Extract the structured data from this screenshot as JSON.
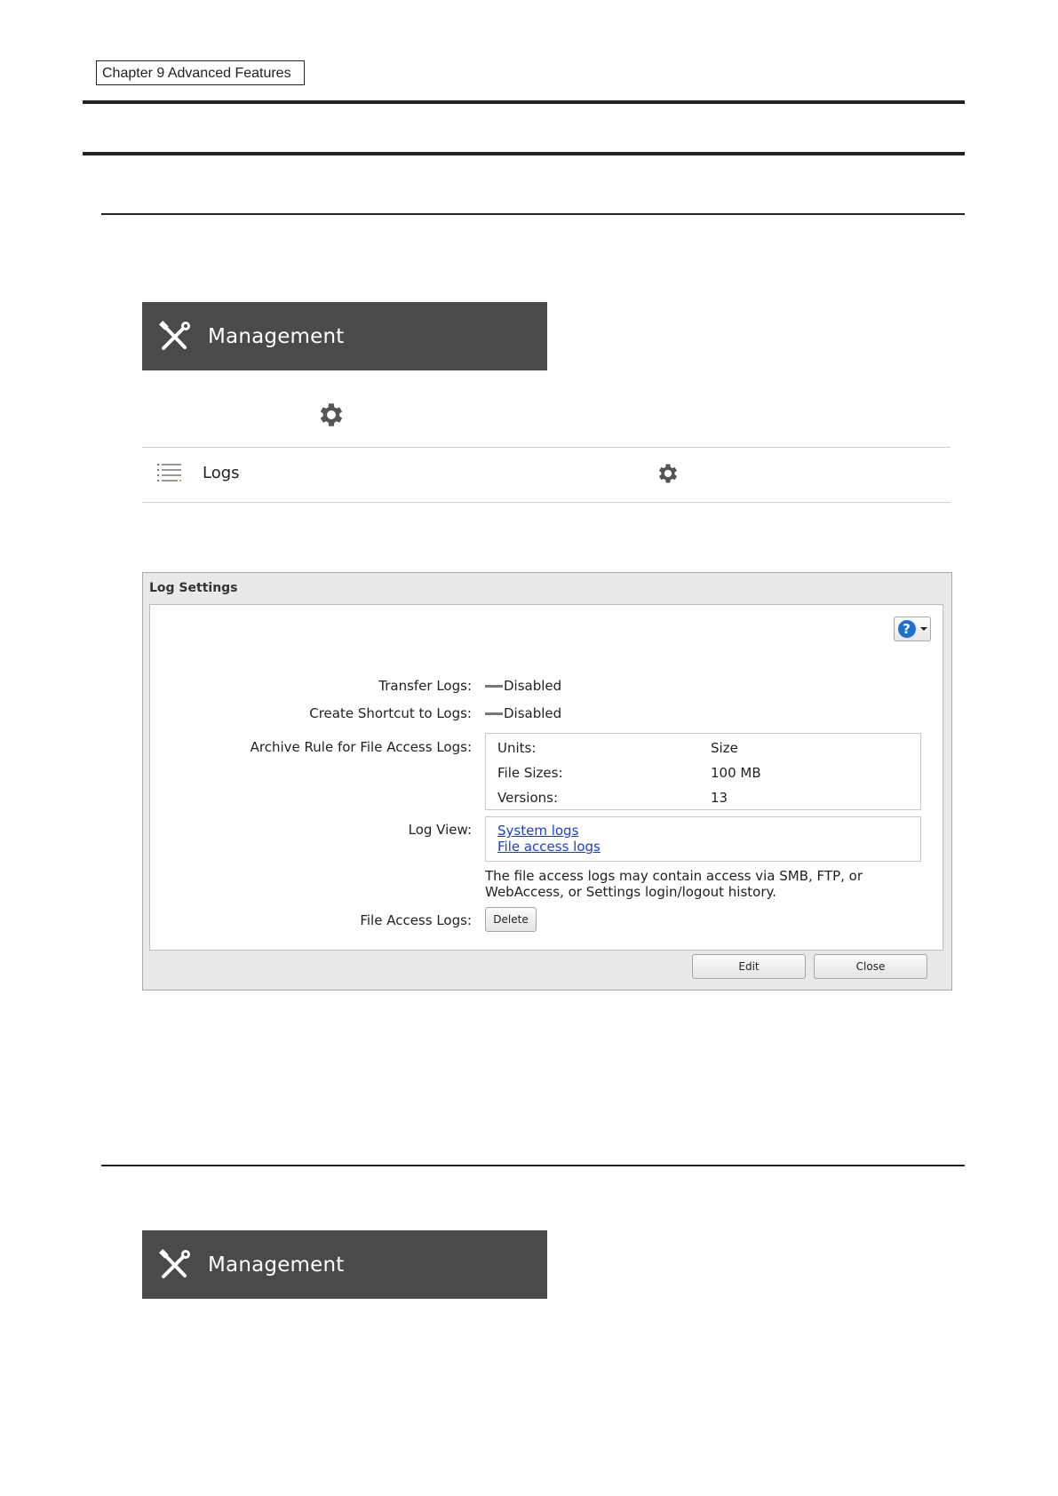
{
  "header": {
    "chapter": "Chapter 9 Advanced Features"
  },
  "management_bar_1": {
    "label": "Management"
  },
  "management_bar_2": {
    "label": "Management"
  },
  "logs_row": {
    "label": "Logs"
  },
  "dialog": {
    "title": "Log Settings",
    "help_symbol": "?",
    "transfer_logs": {
      "label": "Transfer Logs:",
      "value": "Disabled"
    },
    "create_shortcut": {
      "label": "Create Shortcut to Logs:",
      "value": "Disabled"
    },
    "archive_rule": {
      "label": "Archive Rule for File Access Logs:",
      "rows": [
        {
          "key": "Units:",
          "value": "Size"
        },
        {
          "key": "File Sizes:",
          "value": "100 MB"
        },
        {
          "key": "Versions:",
          "value": "13"
        }
      ]
    },
    "log_view": {
      "label": "Log View:",
      "links": [
        "System logs",
        "File access logs"
      ],
      "note": "The file access logs may contain access via SMB, FTP, or WebAccess, or Settings login/logout history."
    },
    "file_access_logs": {
      "label": "File Access Logs:",
      "delete_button": "Delete"
    },
    "footer": {
      "edit_button": "Edit",
      "close_button": "Close"
    }
  },
  "colors": {
    "bar": "#4a4a4a",
    "link": "#1b3fd6",
    "help": "#1e6fd0"
  },
  "icons": [
    "tools-icon",
    "gear-icon",
    "list-icon",
    "help-icon"
  ]
}
